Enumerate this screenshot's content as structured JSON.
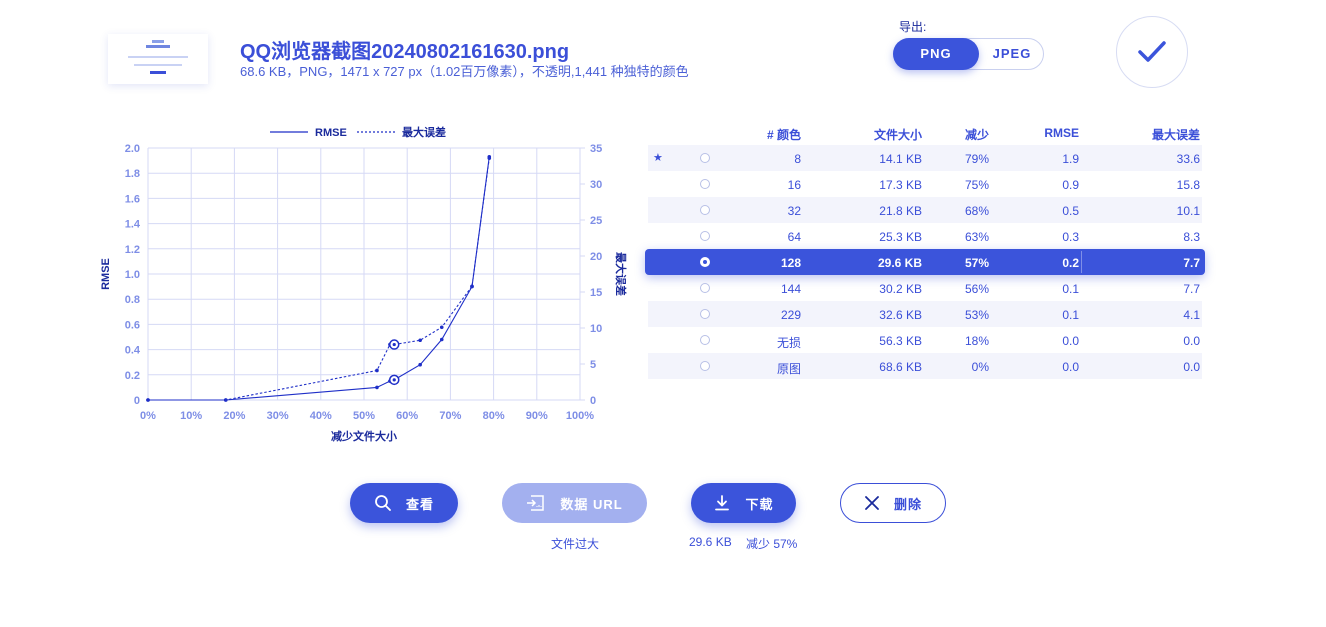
{
  "file": {
    "name": "QQ浏览器截图20240802161630.png",
    "meta": "68.6 KB，PNG，1471 x 727 px（1.02百万像素），不透明,1,441 种独特的颜色"
  },
  "export": {
    "label": "导出:",
    "formats": [
      "PNG",
      "JPEG"
    ],
    "selected": "PNG"
  },
  "icons": {
    "confirm": "check-icon",
    "view": "search-icon",
    "data_url": "data-url-icon",
    "download": "download-icon",
    "delete": "close-icon",
    "best": "star-icon"
  },
  "colors": {
    "accent": "#3b54db",
    "accent_disabled": "#a3b0ef",
    "row_alt": "#f3f4fc",
    "grid": "#d5d9f5"
  },
  "table": {
    "headers": [
      "# 颜色",
      "文件大小",
      "减少",
      "RMSE",
      "最大误差"
    ],
    "rows": [
      {
        "star": "★",
        "colors": "8",
        "size": "14.1 KB",
        "reduction": "79%",
        "rmse": "1.9",
        "max_error": "33.6",
        "selected": false
      },
      {
        "star": "",
        "colors": "16",
        "size": "17.3 KB",
        "reduction": "75%",
        "rmse": "0.9",
        "max_error": "15.8",
        "selected": false
      },
      {
        "star": "",
        "colors": "32",
        "size": "21.8 KB",
        "reduction": "68%",
        "rmse": "0.5",
        "max_error": "10.1",
        "selected": false
      },
      {
        "star": "",
        "colors": "64",
        "size": "25.3 KB",
        "reduction": "63%",
        "rmse": "0.3",
        "max_error": "8.3",
        "selected": false
      },
      {
        "star": "",
        "colors": "128",
        "size": "29.6 KB",
        "reduction": "57%",
        "rmse": "0.2",
        "max_error": "7.7",
        "selected": true
      },
      {
        "star": "",
        "colors": "144",
        "size": "30.2 KB",
        "reduction": "56%",
        "rmse": "0.1",
        "max_error": "7.7",
        "selected": false
      },
      {
        "star": "",
        "colors": "229",
        "size": "32.6 KB",
        "reduction": "53%",
        "rmse": "0.1",
        "max_error": "4.1",
        "selected": false
      },
      {
        "star": "",
        "colors": "无损",
        "size": "56.3 KB",
        "reduction": "18%",
        "rmse": "0.0",
        "max_error": "0.0",
        "selected": false
      },
      {
        "star": "",
        "colors": "原图",
        "size": "68.6 KB",
        "reduction": "0%",
        "rmse": "0.0",
        "max_error": "0.0",
        "selected": false
      }
    ]
  },
  "actions": {
    "view": "查看",
    "data_url": "数据 URL",
    "data_url_note": "文件过大",
    "download": "下载",
    "download_size": "29.6 KB",
    "download_reduction": "减少 57%",
    "delete": "删除"
  },
  "chart_data": {
    "type": "line",
    "title": "",
    "xlabel": "减少文件大小",
    "ylabel": "RMSE",
    "y2label": "最大误差",
    "xlim": [
      0,
      100
    ],
    "ylim": [
      0,
      2.0
    ],
    "y2lim": [
      0,
      35
    ],
    "x_ticks": [
      "0%",
      "10%",
      "20%",
      "30%",
      "40%",
      "50%",
      "60%",
      "70%",
      "80%",
      "90%",
      "100%"
    ],
    "y_ticks": [
      "0",
      "0.2",
      "0.4",
      "0.6",
      "0.8",
      "1.0",
      "1.2",
      "1.4",
      "1.6",
      "1.8",
      "2.0"
    ],
    "y2_ticks": [
      "0",
      "5",
      "10",
      "15",
      "20",
      "25",
      "30",
      "35"
    ],
    "grid": true,
    "legend_position": "top",
    "selected_x": 57,
    "series": [
      {
        "name": "RMSE",
        "style": "solid",
        "axis": "left",
        "points": [
          [
            0,
            0.0
          ],
          [
            18,
            0.0
          ],
          [
            53,
            0.1
          ],
          [
            56,
            0.15
          ],
          [
            57,
            0.16
          ],
          [
            63,
            0.28
          ],
          [
            68,
            0.48
          ],
          [
            75,
            0.9
          ],
          [
            79,
            1.93
          ]
        ]
      },
      {
        "name": "最大误差",
        "style": "dashed",
        "axis": "right",
        "points": [
          [
            0,
            0.0
          ],
          [
            18,
            0.0
          ],
          [
            53,
            4.1
          ],
          [
            56,
            7.7
          ],
          [
            57,
            7.7
          ],
          [
            63,
            8.3
          ],
          [
            68,
            10.1
          ],
          [
            75,
            15.8
          ],
          [
            79,
            33.6
          ]
        ]
      }
    ]
  }
}
